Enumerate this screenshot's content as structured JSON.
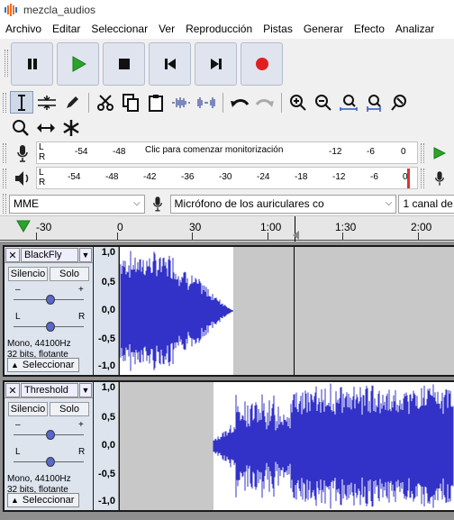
{
  "window": {
    "title": "mezcla_audios"
  },
  "menu": [
    "Archivo",
    "Editar",
    "Seleccionar",
    "Ver",
    "Reproducción",
    "Pistas",
    "Generar",
    "Efecto",
    "Analizar"
  ],
  "transport": {
    "pause": "pause-icon",
    "play": "play-icon",
    "stop": "stop-icon",
    "skip_start": "skip-to-start-icon",
    "skip_end": "skip-to-end-icon",
    "record": "record-icon",
    "play_color": "#2aa42a",
    "record_color": "#e02020"
  },
  "meters": {
    "record_scale": [
      "-54",
      "-48",
      "-12",
      "-6",
      "0"
    ],
    "record_message": "Clic para comenzar monitorización",
    "play_scale": [
      "-54",
      "-48",
      "-42",
      "-36",
      "-30",
      "-24",
      "-18",
      "-12",
      "-6",
      "0"
    ],
    "L": "L",
    "R": "R"
  },
  "devices": {
    "host": "MME",
    "input": "Micrófono de los auriculares co",
    "channels": "1 canal de"
  },
  "ruler": {
    "labels": [
      "-30",
      "0",
      "30",
      "1:00",
      "1:30",
      "2:00"
    ]
  },
  "tracks": [
    {
      "name": "BlackFly",
      "mute": "Silencio",
      "solo": "Solo",
      "gain_minus": "–",
      "gain_plus": "+",
      "pan_left": "L",
      "pan_right": "R",
      "info_line1": "Mono, 44100Hz",
      "info_line2": "32 bits, flotante",
      "select_label": "Seleccionar",
      "scale": [
        "1,0",
        "0,5",
        "0,0",
        "-0,5",
        "-1,0"
      ]
    },
    {
      "name": "Threshold",
      "mute": "Silencio",
      "solo": "Solo",
      "gain_minus": "–",
      "gain_plus": "+",
      "pan_left": "L",
      "pan_right": "R",
      "info_line1": "Mono, 44100Hz",
      "info_line2": "32 bits, flotante",
      "select_label": "Seleccionar",
      "scale": [
        "1,0",
        "0,5",
        "0,0",
        "-0,5",
        "-1,0"
      ]
    }
  ],
  "colors": {
    "waveform": "#3232c8",
    "waveform_dark": "#1a1aa8",
    "selected_bg": "#ffffff",
    "unselected_bg": "#c8c8c8"
  }
}
